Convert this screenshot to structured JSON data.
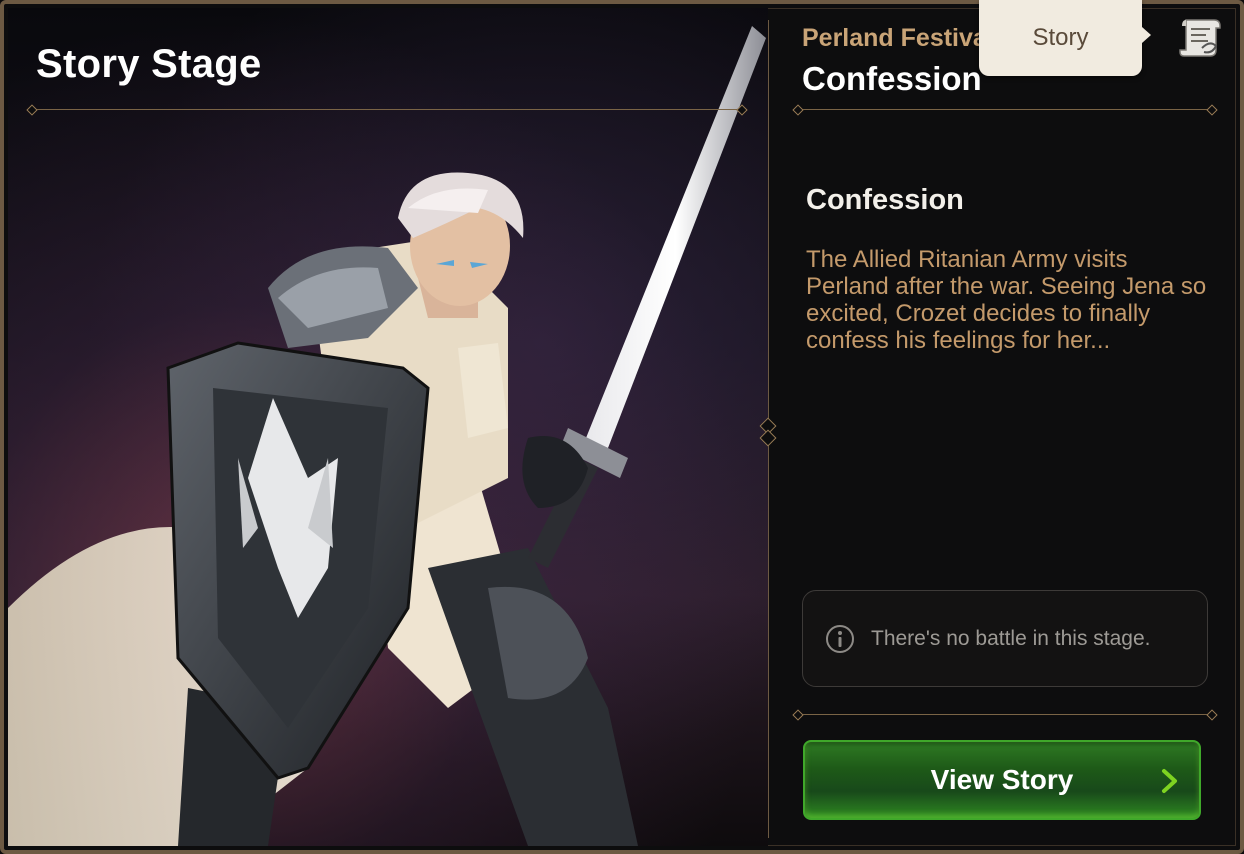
{
  "header": {
    "title": "Story Stage"
  },
  "stage": {
    "chapter": "Perland Festival",
    "name": "Confession",
    "tab_label": "Story"
  },
  "content": {
    "heading": "Confession",
    "description": "The Allied Ritanian Army visits Perland after the war. Seeing Jena so excited, Crozet decides to finally confess his feelings for her...",
    "notice": "There's no battle in this stage.",
    "button_label": "View Story"
  },
  "icons": {
    "tab_icon": "scroll-icon",
    "notice_icon": "info-icon",
    "button_icon": "chevron-right-icon"
  },
  "colors": {
    "accent_gold": "#c9a477",
    "description_text": "#c49a6b",
    "button_green": "#2e7a23",
    "chevron_green": "#7ed321"
  }
}
